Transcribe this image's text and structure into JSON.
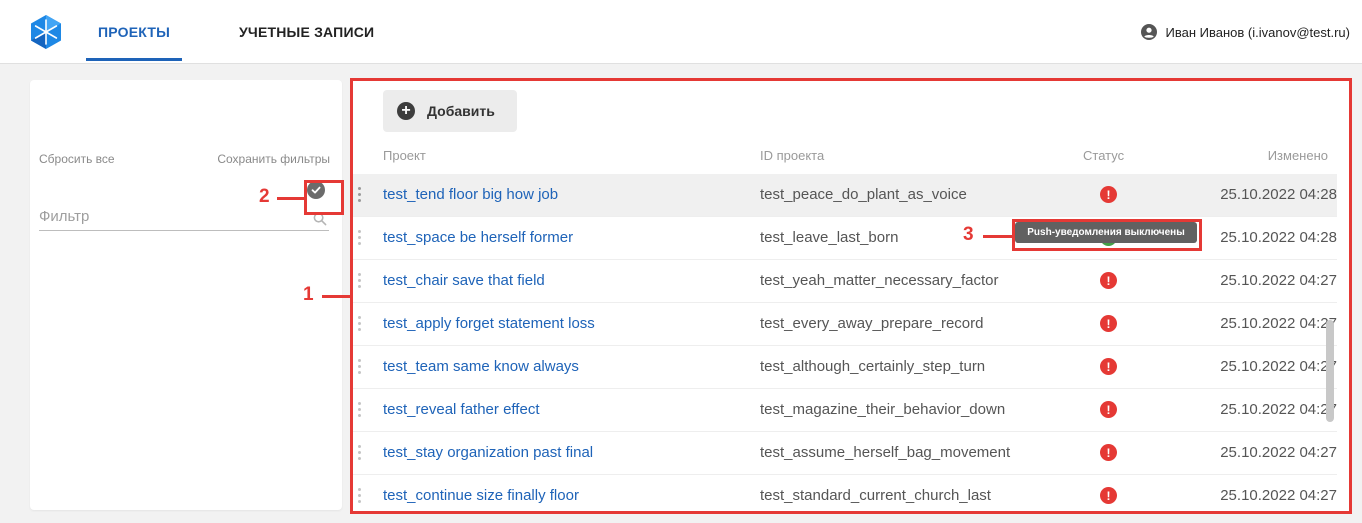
{
  "header": {
    "tabs": [
      {
        "label": "ПРОЕКТЫ",
        "active": true
      },
      {
        "label": "УЧЕТНЫЕ ЗАПИСИ",
        "active": false
      }
    ],
    "user": "Иван Иванов (i.ivanov@test.ru)",
    "user_icon": "account-circle-icon",
    "accent_color": "#1e63b8"
  },
  "filters": {
    "reset_label": "Сбросить все",
    "save_label": "Сохранить фильтры",
    "input_value": "",
    "input_placeholder": "Фильтр"
  },
  "toolbar": {
    "add_label": "Добавить"
  },
  "table": {
    "columns": [
      "Проект",
      "ID проекта",
      "Статус",
      "Изменено"
    ],
    "rows": [
      {
        "name": "test_tend floor big how job",
        "id": "test_peace_do_plant_as_voice",
        "status": "!",
        "date": "25.10.2022 04:28"
      },
      {
        "name": "test_space be herself former",
        "id": "test_leave_last_born",
        "status": "ok",
        "date": "25.10.2022 04:28"
      },
      {
        "name": "test_chair save that field",
        "id": "test_yeah_matter_necessary_factor",
        "status": "!",
        "date": "25.10.2022 04:27"
      },
      {
        "name": "test_apply forget statement loss",
        "id": "test_every_away_prepare_record",
        "status": "!",
        "date": "25.10.2022 04:27"
      },
      {
        "name": "test_team same know always",
        "id": "test_although_certainly_step_turn",
        "status": "!",
        "date": "25.10.2022 04:27"
      },
      {
        "name": "test_reveal father effect",
        "id": "test_magazine_their_behavior_down",
        "status": "!",
        "date": "25.10.2022 04:27"
      },
      {
        "name": "test_stay organization past final",
        "id": "test_assume_herself_bag_movement",
        "status": "!",
        "date": "25.10.2022 04:27"
      },
      {
        "name": "test_continue size finally floor",
        "id": "test_standard_current_church_last",
        "status": "!",
        "date": "25.10.2022 04:27"
      }
    ]
  },
  "tooltip": "Push-уведомления выключены",
  "annotations": {
    "n1": "1",
    "n2": "2",
    "n3": "3",
    "color": "#e53935"
  }
}
